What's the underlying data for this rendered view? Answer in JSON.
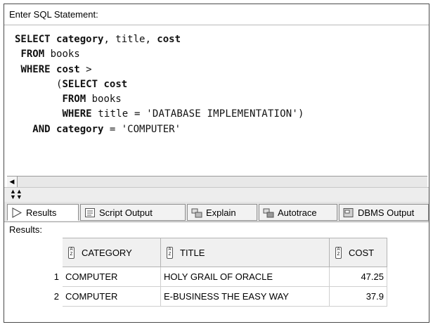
{
  "prompt_label": "Enter SQL Statement:",
  "sql": {
    "line1_kw1": "SELECT",
    "line1_rest1": " category",
    "line1_rest2": ", title, ",
    "line1_rest3": "cost",
    "line2_kw": "FROM",
    "line2_rest": " books",
    "line3_kw": "WHERE",
    "line3_kw2": " cost",
    "line3_rest": " >",
    "line4_open": "(",
    "line4_kw": "SELECT",
    "line4_kw2": " cost",
    "line5_kw": "FROM",
    "line5_rest": " books",
    "line6_kw": "WHERE",
    "line6_rest": " title = 'DATABASE IMPLEMENTATION')",
    "line7_kw": "AND",
    "line7_kw2": " category",
    "line7_rest": " = 'COMPUTER'"
  },
  "icons": {
    "scroll_left": "left-arrow-icon",
    "splitter": "splitter-arrows-icon",
    "results": "results-arrow-icon",
    "script_output": "script-output-icon",
    "explain": "explain-icon",
    "autotrace": "autotrace-icon",
    "dbms_output": "dbms-output-icon",
    "sort": "sort-icon"
  },
  "tabs": [
    {
      "label": "Results"
    },
    {
      "label": "Script Output"
    },
    {
      "label": "Explain"
    },
    {
      "label": "Autotrace"
    },
    {
      "label": "DBMS Output"
    }
  ],
  "results_label": "Results:",
  "table": {
    "columns": [
      "CATEGORY",
      "TITLE",
      "COST"
    ],
    "rows": [
      {
        "num": "1",
        "category": "COMPUTER",
        "title": "HOLY GRAIL OF ORACLE",
        "cost": "47.25"
      },
      {
        "num": "2",
        "category": "COMPUTER",
        "title": "E-BUSINESS THE EASY WAY",
        "cost": "37.9"
      }
    ]
  }
}
